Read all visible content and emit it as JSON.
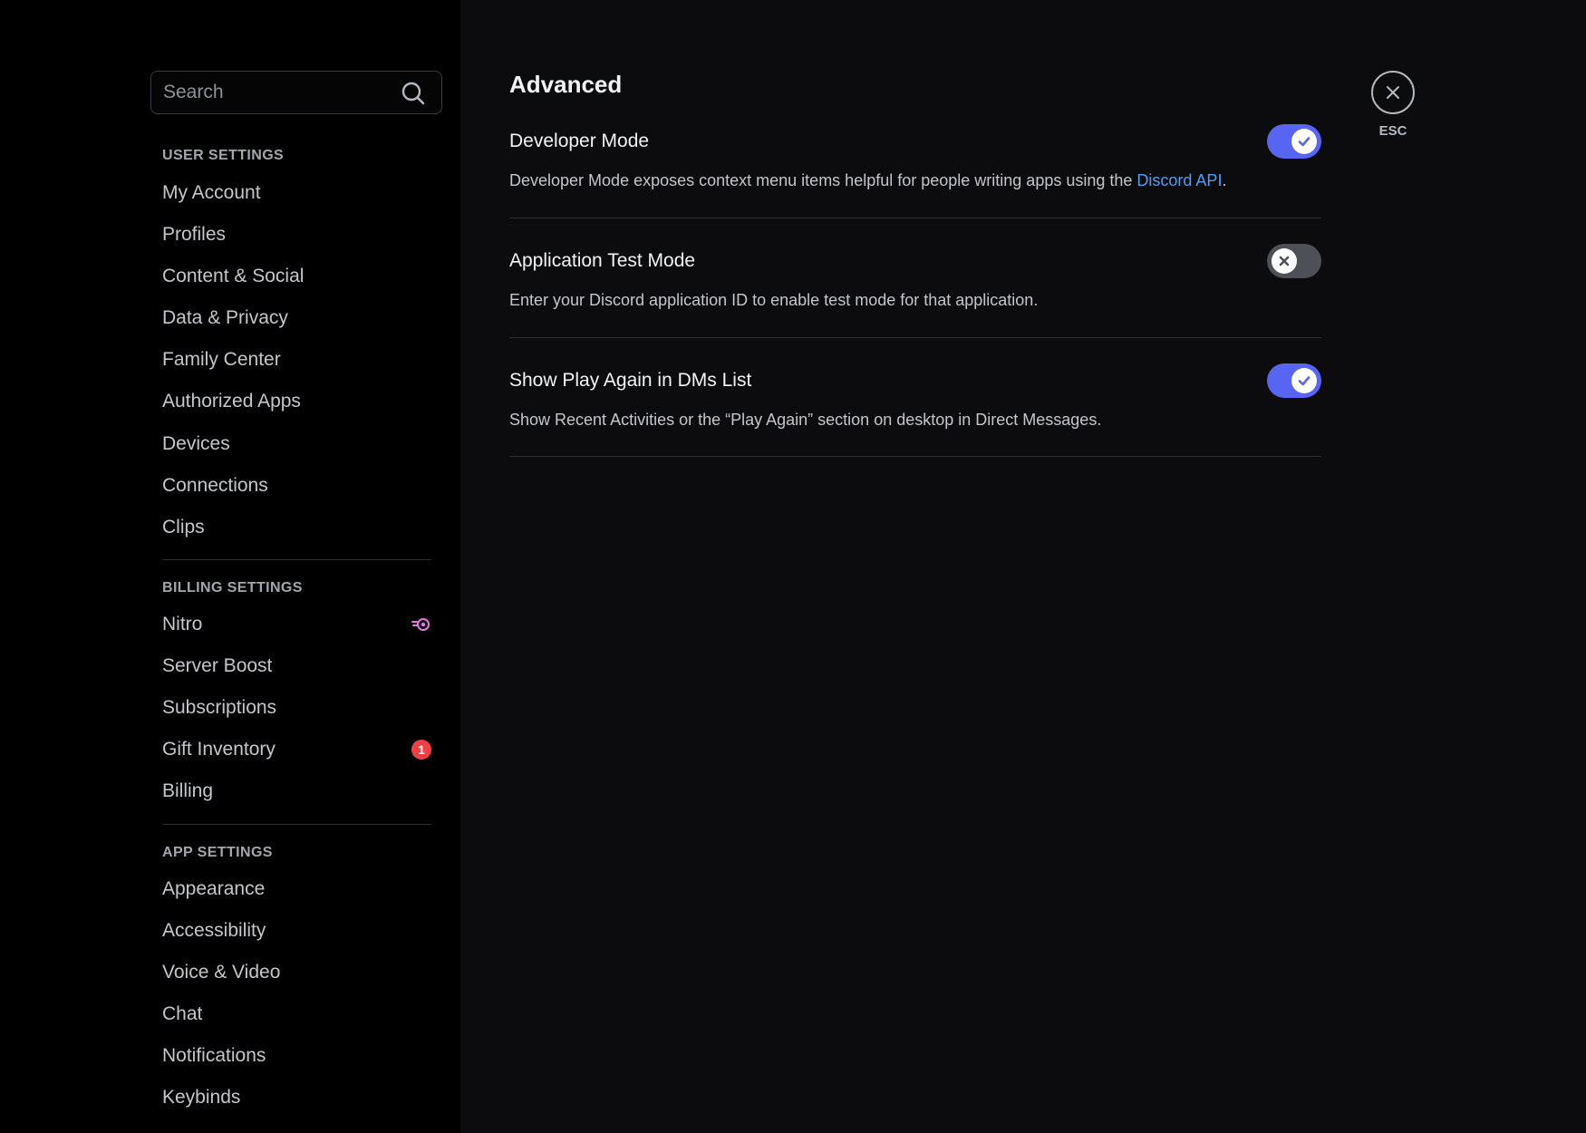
{
  "sidebar": {
    "search": {
      "placeholder": "Search",
      "value": ""
    },
    "sections": {
      "user_settings": "USER SETTINGS",
      "billing_settings": "BILLING SETTINGS",
      "app_settings": "APP SETTINGS"
    },
    "user_items": [
      "My Account",
      "Profiles",
      "Content & Social",
      "Data & Privacy",
      "Family Center",
      "Authorized Apps",
      "Devices",
      "Connections",
      "Clips"
    ],
    "billing_items": [
      "Nitro",
      "Server Boost",
      "Subscriptions",
      "Gift Inventory",
      "Billing"
    ],
    "app_items": [
      "Appearance",
      "Accessibility",
      "Voice & Video",
      "Chat",
      "Notifications",
      "Keybinds"
    ],
    "gift_badge": "1",
    "icons": {
      "nitro": "nitro-icon",
      "search": "search-icon"
    },
    "colors": {
      "nitro": "#e978e6",
      "badge": "#f23f42"
    }
  },
  "main": {
    "title": "Advanced",
    "settings": {
      "developer_mode": {
        "title": "Developer Mode",
        "desc_prefix": "Developer Mode exposes context menu items helpful for people writing apps using the ",
        "link": "Discord API",
        "desc_suffix": ".",
        "enabled": true
      },
      "app_test_mode": {
        "title": "Application Test Mode",
        "desc": "Enter your Discord application ID to enable test mode for that application.",
        "enabled": false
      },
      "play_again": {
        "title": "Show Play Again in DMs List",
        "desc": "Show Recent Activities or the “Play Again” section on desktop in Direct Messages.",
        "enabled": true
      }
    },
    "colors": {
      "toggle_on": "#5865f2",
      "toggle_off": "#4e5058",
      "link": "#4e9ff6"
    }
  },
  "close": {
    "label": "ESC",
    "icon": "close-icon"
  }
}
